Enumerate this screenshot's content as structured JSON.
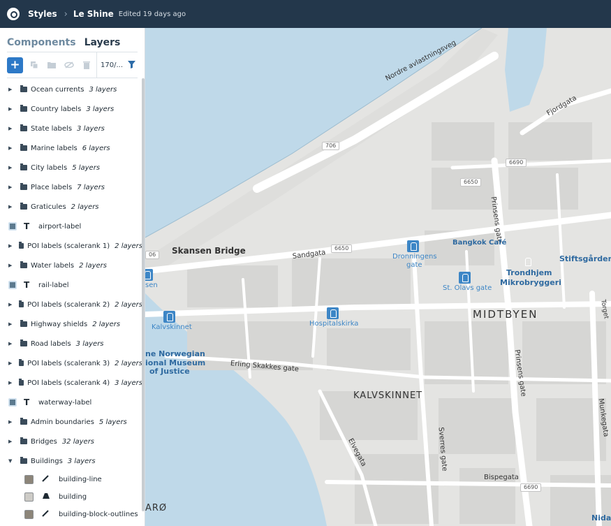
{
  "topbar": {
    "breadcrumb_root": "Styles",
    "separator": "›",
    "style_name": "Le Shine",
    "edited": "Edited 19 days ago"
  },
  "panel": {
    "tabs": [
      {
        "label": "Components",
        "active": false
      },
      {
        "label": "Layers",
        "active": true
      }
    ],
    "toolbar": {
      "add_label": "+",
      "layer_count": "170/...",
      "icons": [
        "duplicate-icon",
        "group-folder-icon",
        "hide-icon",
        "delete-icon",
        "filter-icon"
      ]
    },
    "rows": [
      {
        "kind": "group",
        "name": "Ocean currents",
        "count": "3 layers"
      },
      {
        "kind": "group",
        "name": "Country labels",
        "count": "3 layers"
      },
      {
        "kind": "group",
        "name": "State labels",
        "count": "3 layers"
      },
      {
        "kind": "group",
        "name": "Marine labels",
        "count": "6 layers"
      },
      {
        "kind": "group",
        "name": "City labels",
        "count": "5 layers"
      },
      {
        "kind": "group",
        "name": "Place labels",
        "count": "7 layers"
      },
      {
        "kind": "group",
        "name": "Graticules",
        "count": "2 layers"
      },
      {
        "kind": "layer",
        "name": "airport-label",
        "icon": "symbol-text-icon",
        "swatch": "#5c7a8f"
      },
      {
        "kind": "group",
        "name": "POI labels (scalerank 1)",
        "count": "2 layers"
      },
      {
        "kind": "group",
        "name": "Water labels",
        "count": "2 layers"
      },
      {
        "kind": "layer",
        "name": "rail-label",
        "icon": "symbol-text-icon",
        "swatch": "#5c7a8f"
      },
      {
        "kind": "group",
        "name": "POI labels (scalerank 2)",
        "count": "2 layers"
      },
      {
        "kind": "group",
        "name": "Highway shields",
        "count": "2 layers"
      },
      {
        "kind": "group",
        "name": "Road labels",
        "count": "3 layers"
      },
      {
        "kind": "group",
        "name": "POI labels (scalerank 3)",
        "count": "2 layers"
      },
      {
        "kind": "group",
        "name": "POI labels (scalerank 4)",
        "count": "3 layers"
      },
      {
        "kind": "layer",
        "name": "waterway-label",
        "icon": "symbol-text-icon",
        "swatch": "#5c7a8f"
      },
      {
        "kind": "group",
        "name": "Admin boundaries",
        "count": "5 layers"
      },
      {
        "kind": "group",
        "name": "Bridges",
        "count": "32 layers"
      },
      {
        "kind": "group",
        "name": "Buildings",
        "count": "3 layers",
        "expanded": true
      }
    ],
    "sublayers": [
      {
        "name": "building-line",
        "icon": "line-pencil-icon",
        "swatch": "#8c8579"
      },
      {
        "name": "building",
        "icon": "fill-shape-icon",
        "swatch": "#cdcbc6"
      },
      {
        "name": "building-block-outlines",
        "icon": "line-pencil-icon",
        "swatch": "#8c8579"
      }
    ]
  },
  "map": {
    "colors": {
      "water": "#bfd9e9",
      "land": "#e4e4e2",
      "block": "#d6d6d4",
      "road": "#ffffff",
      "text": "#333333",
      "poi": "#3d86c6"
    },
    "labels": [
      {
        "text": "Nordre avlastningsveg",
        "kind": "street"
      },
      {
        "text": "Fjordgata",
        "kind": "street"
      },
      {
        "text": "Prinsens gate",
        "kind": "street"
      },
      {
        "text": "Skansen Bridge",
        "kind": "place"
      },
      {
        "text": "Sandgata",
        "kind": "street"
      },
      {
        "text": "Dronningens",
        "kind": "poi"
      },
      {
        "text": "gate",
        "kind": "poi"
      },
      {
        "text": "Bangkok Café",
        "kind": "poi"
      },
      {
        "text": "Trondhjem",
        "kind": "poi-dark"
      },
      {
        "text": "Mikrobryggeri",
        "kind": "poi-dark"
      },
      {
        "text": "Stiftsgården",
        "kind": "poi"
      },
      {
        "text": "St. Olavs gate",
        "kind": "poi"
      },
      {
        "text": "MIDTBYEN",
        "kind": "district"
      },
      {
        "text": "Torget",
        "kind": "street"
      },
      {
        "text": "Kalvskinnet",
        "kind": "poi"
      },
      {
        "text": "Hospitalskirka",
        "kind": "poi"
      },
      {
        "text": "sen",
        "kind": "poi"
      },
      {
        "text": "ne Norwegian",
        "kind": "poi-dark"
      },
      {
        "text": "ional Museum",
        "kind": "poi-dark"
      },
      {
        "text": "of Justice",
        "kind": "poi-dark"
      },
      {
        "text": "Erling Skakkes gate",
        "kind": "street"
      },
      {
        "text": "KALVSKINNET",
        "kind": "district"
      },
      {
        "text": "Elvegata",
        "kind": "street"
      },
      {
        "text": "Sverres gate",
        "kind": "street"
      },
      {
        "text": "Prinsens gate",
        "kind": "street"
      },
      {
        "text": "Munkegata",
        "kind": "street"
      },
      {
        "text": "Bispegata",
        "kind": "street"
      },
      {
        "text": "ARØ",
        "kind": "district"
      },
      {
        "text": "Nidar",
        "kind": "poi-dark"
      }
    ],
    "shields": [
      "706",
      "6690",
      "6650",
      "6650",
      "06",
      "6690"
    ]
  }
}
